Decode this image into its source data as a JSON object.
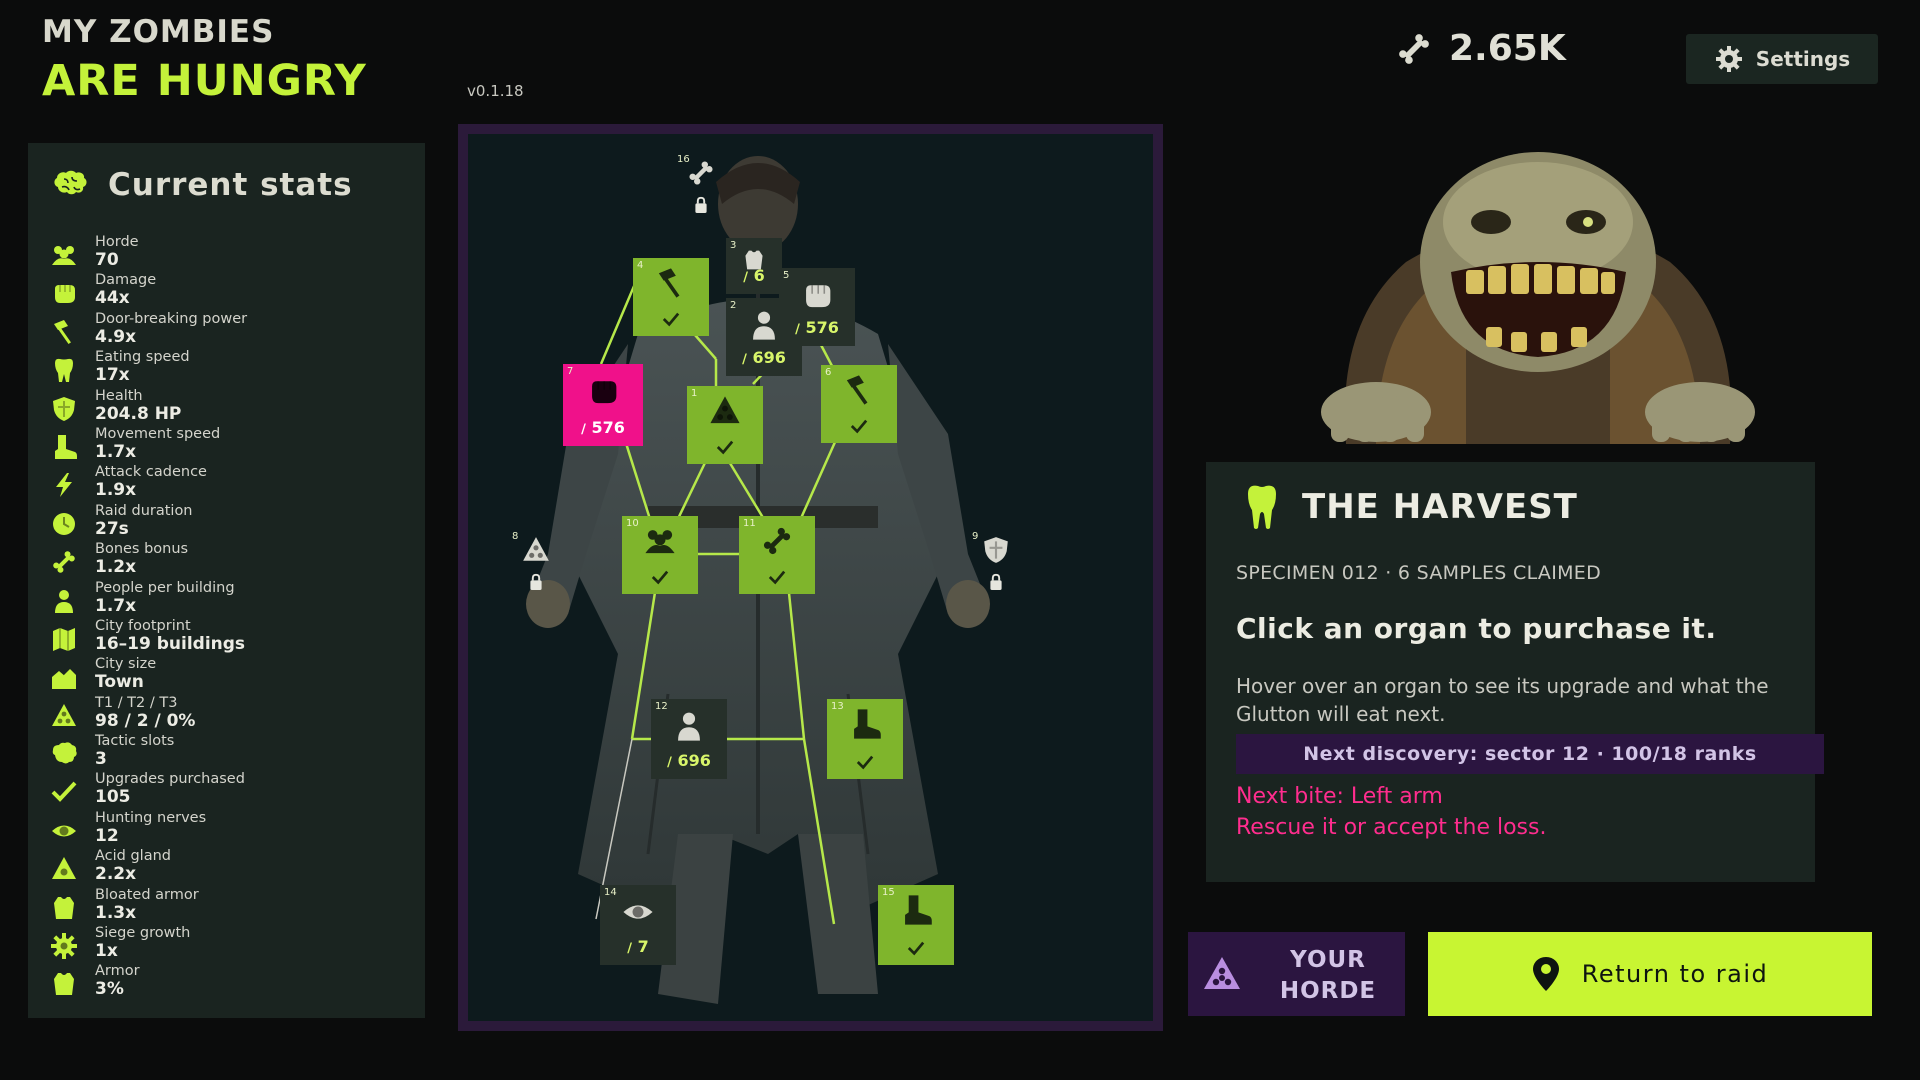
{
  "header": {
    "title_line1": "MY ZOMBIES",
    "title_line2": "ARE HUNGRY",
    "version": "v0.1.18",
    "bones": "2.65K",
    "settings_label": "Settings"
  },
  "stats": {
    "title": "Current stats",
    "items": [
      {
        "label": "Horde",
        "value": "70",
        "icon": "horde-icon"
      },
      {
        "label": "Damage",
        "value": "44x",
        "icon": "fist-icon"
      },
      {
        "label": "Door-breaking power",
        "value": "4.9x",
        "icon": "hammer-icon"
      },
      {
        "label": "Eating speed",
        "value": "17x",
        "icon": "tooth-icon"
      },
      {
        "label": "Health",
        "value": "204.8 HP",
        "icon": "shield-icon"
      },
      {
        "label": "Movement speed",
        "value": "1.7x",
        "icon": "boot-icon"
      },
      {
        "label": "Attack cadence",
        "value": "1.9x",
        "icon": "lightning-icon"
      },
      {
        "label": "Raid duration",
        "value": "27s",
        "icon": "clock-icon"
      },
      {
        "label": "Bones bonus",
        "value": "1.2x",
        "icon": "bone-icon"
      },
      {
        "label": "People per building",
        "value": "1.7x",
        "icon": "person-icon"
      },
      {
        "label": "City footprint",
        "value": "16–19 buildings",
        "icon": "map-icon"
      },
      {
        "label": "City size",
        "value": "Town",
        "icon": "town-icon"
      },
      {
        "label": "T1 / T2 / T3",
        "value": "98 / 2 / 0%",
        "icon": "biohazard-icon"
      },
      {
        "label": "Tactic slots",
        "value": "3",
        "icon": "brain-icon"
      },
      {
        "label": "Upgrades purchased",
        "value": "105",
        "icon": "check-icon"
      },
      {
        "label": "Hunting nerves",
        "value": "12",
        "icon": "eye-icon"
      },
      {
        "label": "Acid gland",
        "value": "2.2x",
        "icon": "acid-icon"
      },
      {
        "label": "Bloated armor",
        "value": "1.3x",
        "icon": "vest-icon"
      },
      {
        "label": "Siege growth",
        "value": "1x",
        "icon": "gear-icon"
      },
      {
        "label": "Armor",
        "value": "3%",
        "icon": "vest-icon"
      }
    ]
  },
  "tree": {
    "nodes": [
      {
        "num": "1",
        "state": "purchased",
        "icon": "biohazard-icon",
        "cost": ""
      },
      {
        "num": "2",
        "state": "available",
        "icon": "person-icon",
        "cost": "696"
      },
      {
        "num": "3",
        "state": "available",
        "icon": "vest-icon",
        "cost": "6"
      },
      {
        "num": "4",
        "state": "purchased",
        "icon": "hammer-icon",
        "cost": ""
      },
      {
        "num": "5",
        "state": "available",
        "icon": "fist-icon",
        "cost": "576"
      },
      {
        "num": "6",
        "state": "purchased",
        "icon": "hammer-icon",
        "cost": ""
      },
      {
        "num": "7",
        "state": "selected",
        "icon": "fist-icon",
        "cost": "576"
      },
      {
        "num": "8",
        "state": "locked",
        "icon": "biohazard-icon",
        "cost": ""
      },
      {
        "num": "9",
        "state": "locked",
        "icon": "shield-icon",
        "cost": ""
      },
      {
        "num": "10",
        "state": "purchased",
        "icon": "horde-icon",
        "cost": ""
      },
      {
        "num": "11",
        "state": "purchased",
        "icon": "bone-icon",
        "cost": ""
      },
      {
        "num": "12",
        "state": "available",
        "icon": "person-icon",
        "cost": "696"
      },
      {
        "num": "13",
        "state": "purchased",
        "icon": "boot-icon",
        "cost": ""
      },
      {
        "num": "14",
        "state": "available",
        "icon": "eye-icon",
        "cost": "7"
      },
      {
        "num": "15",
        "state": "purchased",
        "icon": "boot-icon",
        "cost": ""
      },
      {
        "num": "16",
        "state": "locked",
        "icon": "bone-icon",
        "cost": ""
      }
    ]
  },
  "info": {
    "title": "THE HARVEST",
    "subtitle": "SPECIMEN 012 · 6 SAMPLES CLAIMED",
    "cta": "Click an organ to purchase it.",
    "description": "Hover over an organ to see its upgrade and what the Glutton will eat next.",
    "discovery": "Next discovery: sector 12 · 100/18 ranks",
    "bite_line1": "Next bite: Left arm",
    "bite_line2": "Rescue it or accept the loss."
  },
  "buttons": {
    "horde_label": "YOUR HORDE",
    "raid_label": "Return to raid"
  },
  "colors": {
    "accent_lime": "#c4f23a",
    "node_green": "#7fb52c",
    "node_pink": "#f0118a",
    "danger_pink": "#ff2d8e",
    "panel_bg": "#1a2420",
    "purple": "#2b1540"
  }
}
